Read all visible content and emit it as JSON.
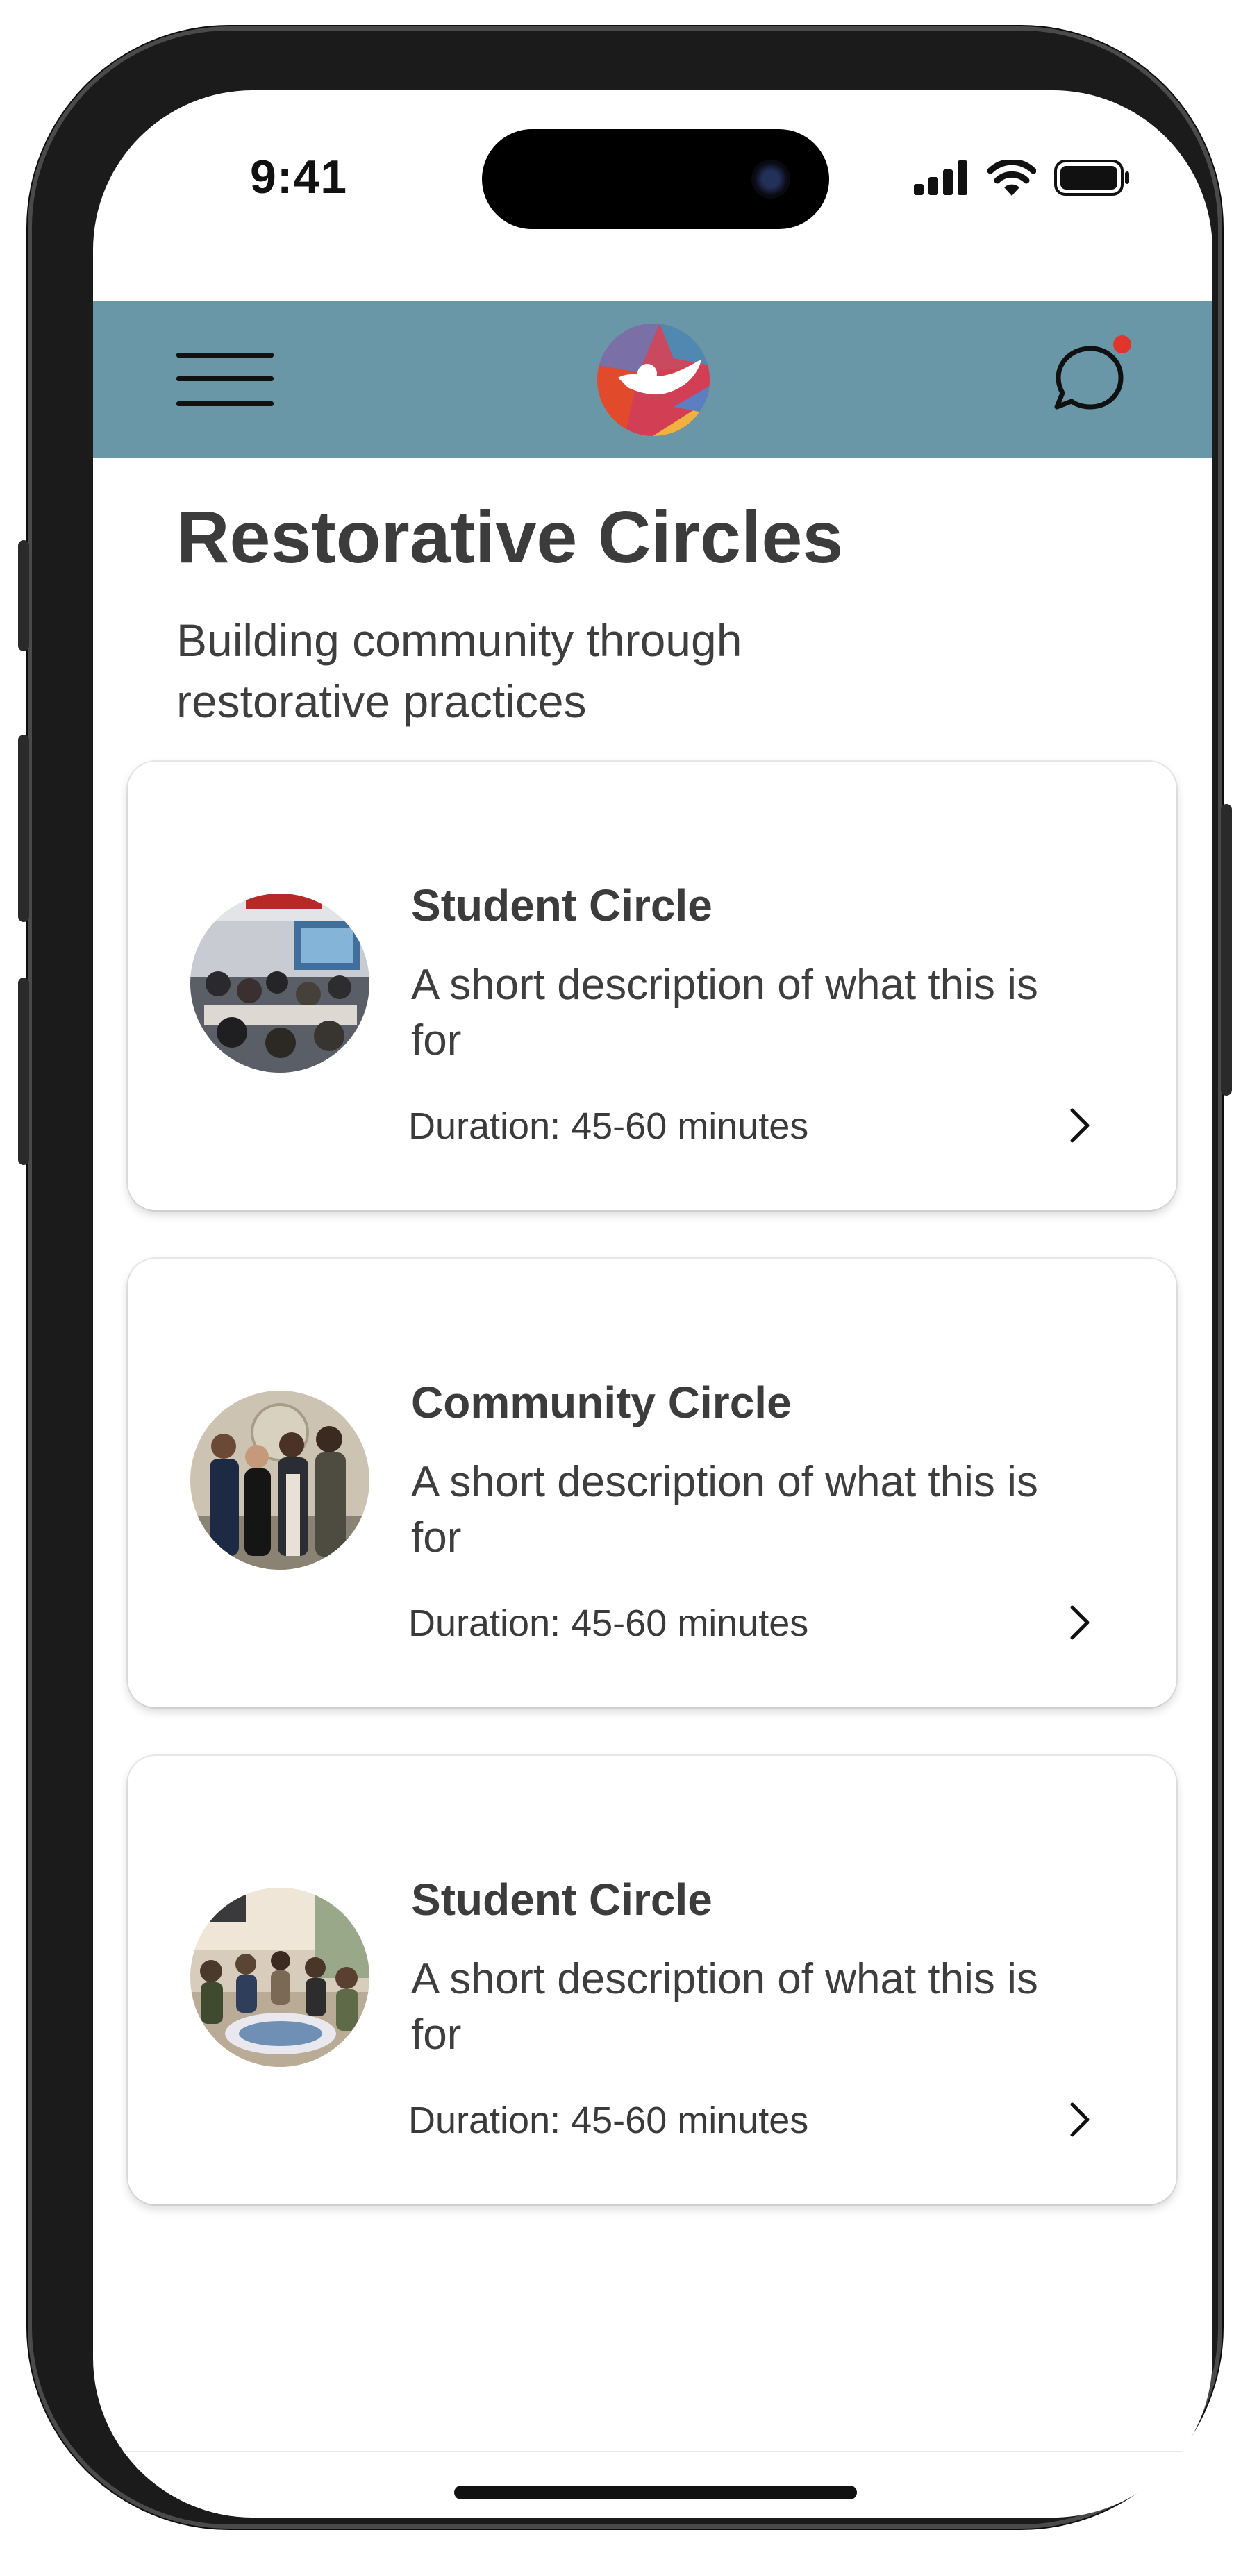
{
  "status_bar": {
    "time": "9:41",
    "icons": [
      "signal-icon",
      "wifi-icon",
      "battery-icon"
    ]
  },
  "header": {
    "background": "#6a97a8",
    "menu_icon": "hamburger-menu-icon",
    "logo": "app-logo",
    "chat_icon": "chat-bubble-icon",
    "notification_dot_color": "#e0352b"
  },
  "page": {
    "title": "Restorative Circles",
    "subtitle": "Building community through restorative practices"
  },
  "cards": [
    {
      "title": "Student Circle",
      "description": "A short description of what this is for",
      "duration": "Duration: 45-60 minutes",
      "image": "classroom-photo",
      "chevron_icon": "chevron-right-icon"
    },
    {
      "title": "Community Circle",
      "description": "A short description of what this is for",
      "duration": "Duration: 45-60 minutes",
      "image": "group-portrait-photo",
      "chevron_icon": "chevron-right-icon"
    },
    {
      "title": "Student Circle",
      "description": "A short description of what this is for",
      "duration": "Duration: 45-60 minutes",
      "image": "seated-circle-photo",
      "chevron_icon": "chevron-right-icon"
    }
  ]
}
